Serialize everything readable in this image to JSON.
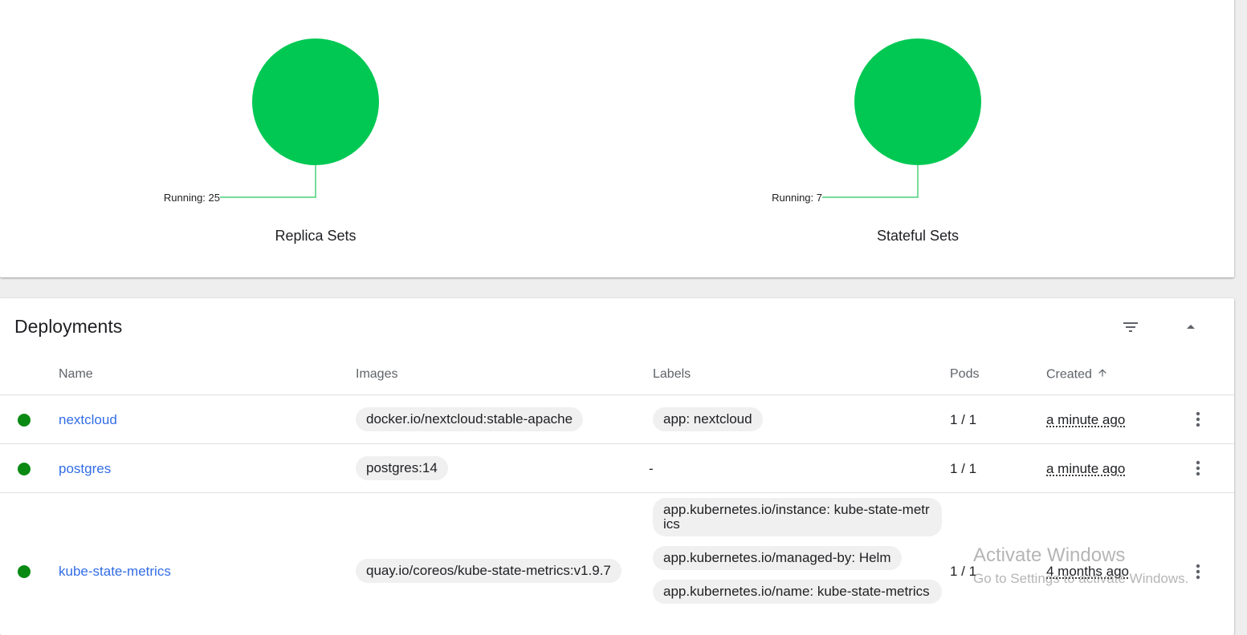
{
  "workloads": {
    "charts": [
      {
        "title": "Replica Sets",
        "running_label": "Running: 25",
        "running": 25,
        "color": "#00c853"
      },
      {
        "title": "Stateful Sets",
        "running_label": "Running: 7",
        "running": 7,
        "color": "#00c853"
      }
    ]
  },
  "deployments": {
    "title": "Deployments",
    "filter_icon": "filter-icon",
    "collapse_icon": "collapse-icon",
    "columns": {
      "name": "Name",
      "images": "Images",
      "labels": "Labels",
      "pods": "Pods",
      "created": "Created"
    },
    "rows": [
      {
        "status": "running",
        "name": "nextcloud",
        "image": "docker.io/nextcloud:stable-apache",
        "labels": [
          "app: nextcloud"
        ],
        "pods": "1 / 1",
        "created": "a minute ago"
      },
      {
        "status": "running",
        "name": "postgres",
        "image": "postgres:14",
        "labels_empty": "-",
        "pods": "1 / 1",
        "created": "a minute ago"
      },
      {
        "status": "running",
        "name": "kube-state-metrics",
        "image": "quay.io/coreos/kube-state-metrics:v1.9.7",
        "labels": [
          "app.kubernetes.io/instance: kube-state-metrics",
          "app.kubernetes.io/managed-by: Helm",
          "app.kubernetes.io/name: kube-state-metrics"
        ],
        "pods": "1 / 1",
        "created": "4 months ago"
      }
    ]
  },
  "watermark": {
    "line1": "Activate Windows",
    "line2": "Go to Settings to activate Windows."
  },
  "colors": {
    "running": "#00c853",
    "status_dot": "#0a8a13",
    "link": "#326de6"
  }
}
